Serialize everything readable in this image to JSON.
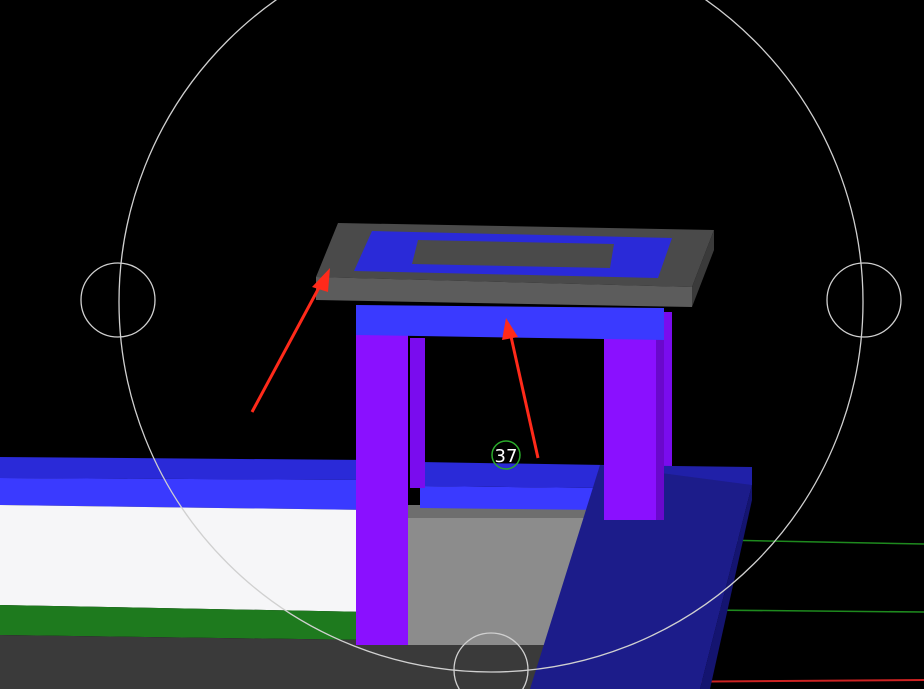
{
  "viewport": {
    "name": "3d-model-viewport",
    "background_color": "#000000"
  },
  "colors": {
    "slab_top": "#4a4a4a",
    "slab_front": "#5a5a5a",
    "slab_side": "#3c3c3c",
    "blue": "#3a3aff",
    "blue_dark": "#2020c8",
    "navy": "#1c1c8a",
    "purple": "#8a10ff",
    "purple_dark": "#6a08cc",
    "grey": "#8c8c8c",
    "white": "#f6f6f8",
    "green": "#1e7a1e",
    "green_line": "#22aa22",
    "red_line": "#cc2222",
    "annotation_arrow": "#ff2a1a",
    "gizmo_stroke": "#d0d0d0",
    "marker_stroke": "#2aaa2a"
  },
  "gizmo": {
    "name": "orbit-gizmo"
  },
  "node_marker": {
    "label": "37"
  },
  "annotations": [
    {
      "name": "annotation-arrow-slab-edge",
      "icon": "arrow-icon"
    },
    {
      "name": "annotation-arrow-beam",
      "icon": "arrow-icon"
    }
  ]
}
